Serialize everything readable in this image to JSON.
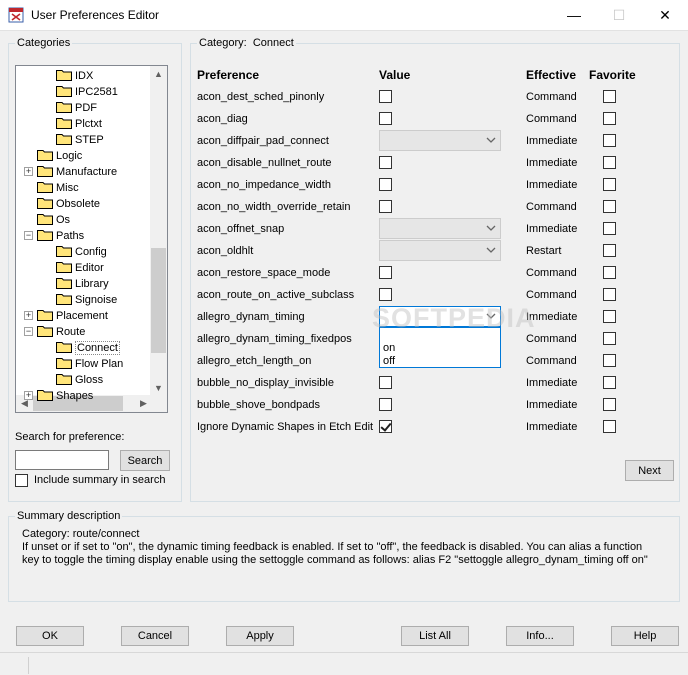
{
  "window": {
    "title": "User Preferences Editor",
    "minimize": "—",
    "maximize": "☐",
    "close": "✕"
  },
  "categories": {
    "legend": "Categories",
    "tree": [
      {
        "label": "IDX",
        "level": 2,
        "expander": ""
      },
      {
        "label": "IPC2581",
        "level": 2,
        "expander": ""
      },
      {
        "label": "PDF",
        "level": 2,
        "expander": ""
      },
      {
        "label": "Plctxt",
        "level": 2,
        "expander": ""
      },
      {
        "label": "STEP",
        "level": 2,
        "expander": ""
      },
      {
        "label": "Logic",
        "level": 1,
        "expander": ""
      },
      {
        "label": "Manufacture",
        "level": 1,
        "expander": "+"
      },
      {
        "label": "Misc",
        "level": 1,
        "expander": ""
      },
      {
        "label": "Obsolete",
        "level": 1,
        "expander": ""
      },
      {
        "label": "Os",
        "level": 1,
        "expander": ""
      },
      {
        "label": "Paths",
        "level": 1,
        "expander": "−"
      },
      {
        "label": "Config",
        "level": 2,
        "expander": ""
      },
      {
        "label": "Editor",
        "level": 2,
        "expander": ""
      },
      {
        "label": "Library",
        "level": 2,
        "expander": ""
      },
      {
        "label": "Signoise",
        "level": 2,
        "expander": ""
      },
      {
        "label": "Placement",
        "level": 1,
        "expander": "+"
      },
      {
        "label": "Route",
        "level": 1,
        "expander": "−"
      },
      {
        "label": "Connect",
        "level": 2,
        "expander": "",
        "selected": true
      },
      {
        "label": "Flow Plan",
        "level": 2,
        "expander": ""
      },
      {
        "label": "Gloss",
        "level": 2,
        "expander": ""
      },
      {
        "label": "Shapes",
        "level": 1,
        "expander": "+"
      }
    ],
    "search_label": "Search for preference:",
    "search_value": "",
    "search_button": "Search",
    "include_summary_label": "Include summary in search",
    "include_summary_checked": false
  },
  "category_panel": {
    "legend_label": "Category:",
    "legend_value": "Connect",
    "headers": {
      "preference": "Preference",
      "value": "Value",
      "effective": "Effective",
      "favorite": "Favorite"
    },
    "rows": [
      {
        "name": "acon_dest_sched_pinonly",
        "value_type": "checkbox",
        "checked": false,
        "effective": "Command"
      },
      {
        "name": "acon_diag",
        "value_type": "checkbox",
        "checked": false,
        "effective": "Command"
      },
      {
        "name": "acon_diffpair_pad_connect",
        "value_type": "combo",
        "effective": "Immediate"
      },
      {
        "name": "acon_disable_nullnet_route",
        "value_type": "checkbox",
        "checked": false,
        "effective": "Immediate"
      },
      {
        "name": "acon_no_impedance_width",
        "value_type": "checkbox",
        "checked": false,
        "effective": "Immediate"
      },
      {
        "name": "acon_no_width_override_retain",
        "value_type": "checkbox",
        "checked": false,
        "effective": "Command"
      },
      {
        "name": "acon_offnet_snap",
        "value_type": "combo",
        "effective": "Immediate"
      },
      {
        "name": "acon_oldhlt",
        "value_type": "combo",
        "effective": "Restart"
      },
      {
        "name": "acon_restore_space_mode",
        "value_type": "checkbox",
        "checked": false,
        "effective": "Command"
      },
      {
        "name": "acon_route_on_active_subclass",
        "value_type": "checkbox",
        "checked": false,
        "effective": "Command"
      },
      {
        "name": "allegro_dynam_timing",
        "value_type": "combo-active",
        "effective": "Immediate"
      },
      {
        "name": "allegro_dynam_timing_fixedpos",
        "value_type": "none",
        "effective": "Command"
      },
      {
        "name": "allegro_etch_length_on",
        "value_type": "none",
        "effective": "Command"
      },
      {
        "name": "bubble_no_display_invisible",
        "value_type": "checkbox",
        "checked": false,
        "effective": "Immediate"
      },
      {
        "name": "bubble_shove_bondpads",
        "value_type": "checkbox",
        "checked": false,
        "effective": "Immediate"
      },
      {
        "name": "Ignore Dynamic Shapes in Etch Edit",
        "value_type": "checkbox",
        "checked": true,
        "effective": "Immediate"
      }
    ],
    "dropdown_options": [
      "on",
      "off"
    ],
    "next_button": "Next"
  },
  "watermark": "SOFTPEDIA",
  "summary": {
    "legend": "Summary description",
    "line1": "Category: route/connect",
    "line2": "If unset or if set to \"on\", the dynamic timing feedback is enabled. If set to \"off\",  the feedback is disabled.  You can alias a function",
    "line3": "key to toggle the timing display enable using the settoggle command as follows: alias F2 \"settoggle allegro_dynam_timing off on\""
  },
  "buttons": {
    "ok": "OK",
    "cancel": "Cancel",
    "apply": "Apply",
    "list_all": "List All",
    "info": "Info...",
    "help": "Help"
  }
}
